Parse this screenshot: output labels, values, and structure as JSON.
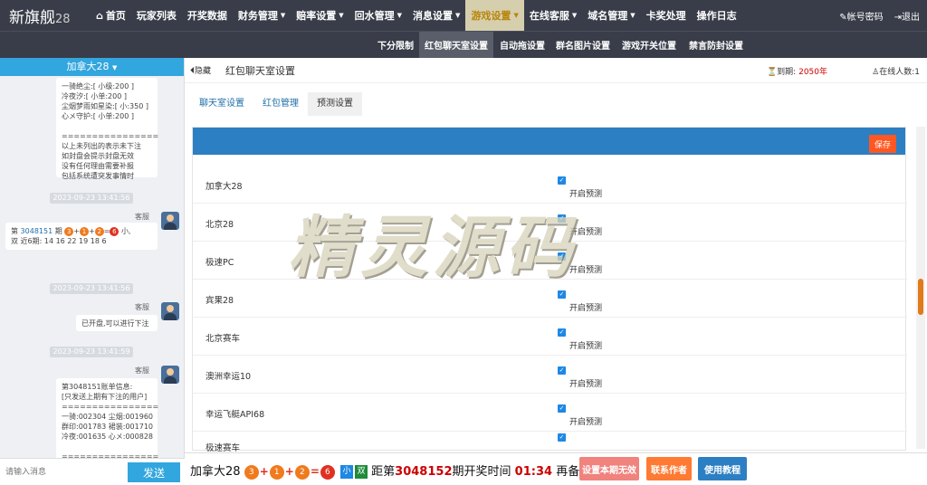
{
  "brand": {
    "name": "新旗舰",
    "suffix": "28"
  },
  "nav": [
    {
      "label": "首页",
      "icon": "home-icon"
    },
    {
      "label": "玩家列表"
    },
    {
      "label": "开奖数据"
    },
    {
      "label": "财务管理",
      "dropdown": true
    },
    {
      "label": "赔率设置",
      "dropdown": true
    },
    {
      "label": "回水管理",
      "dropdown": true
    },
    {
      "label": "消息设置",
      "dropdown": true
    },
    {
      "label": "游戏设置",
      "dropdown": true,
      "active": true
    },
    {
      "label": "在线客服",
      "dropdown": true
    },
    {
      "label": "域名管理",
      "dropdown": true
    },
    {
      "label": "卡奖处理"
    },
    {
      "label": "操作日志"
    }
  ],
  "top_right": {
    "account": "帐号密码",
    "logout": "退出"
  },
  "subnav": [
    "下分限制",
    "红包聊天室设置",
    "自动拖设置",
    "群名图片设置",
    "游戏开关位置",
    "禁言防封设置"
  ],
  "chat": {
    "room": "加拿大28",
    "msg1": "一骑绝尘:[ 小级:200 ]\n冷夜汐:[ 小单:200 ]\n尘烟梦雨如星染:[ 小:350 ]\n心メ守护:[ 小单:200 ]\n\n================\n以上未列出的表示未下注\n如封盘会提示封盘无效\n没有任何理由需要补报\n包括系统遭突发事情时",
    "ts1": "2023-09-23 13:41:56",
    "sender": "客服",
    "msg2": {
      "prefix": "第",
      "period": "3048151",
      "mid": "期",
      "balls": [
        "3",
        "1",
        "2"
      ],
      "sum": "6",
      "result": "小,",
      "line2": "双 近6期: 14 16 22 19 18 6"
    },
    "ts2": "2023-09-23 13:41:56",
    "msg3": "已开盘,可以进行下注",
    "ts3": "2023-09-23 13:41:59",
    "msg4": "第3048151账单信息:\n[只发送上期有下注的用户]\n================\n一骑:002304 尘烟:001960\n群印:001783 裙装:001710\n冷夜:001635 心メ:000828\n\n================",
    "input_placeholder": "请输入消息",
    "send": "发送"
  },
  "content": {
    "hide": "隐藏",
    "title": "红包聊天室设置",
    "expire_label": "到期:",
    "expire_year": "2050年",
    "online_label": "在线人数:",
    "online_count": "1",
    "tabs": [
      "聊天室设置",
      "红包管理",
      "预测设置"
    ],
    "active_tab": 2,
    "save": "保存",
    "check_label": "开启预测",
    "rows": [
      "加拿大28",
      "北京28",
      "极速PC",
      "宾果28",
      "北京赛车",
      "澳洲幸运10",
      "幸运飞艇API68",
      "极速赛车"
    ]
  },
  "watermark": "精灵源码",
  "bottom": {
    "lottery": "加拿大28",
    "balls": [
      "3",
      "1",
      "2"
    ],
    "sum": "6",
    "tag1": "小",
    "tag2": "双",
    "pre": "距第",
    "period": "3048152",
    "post": "期开奖时间",
    "countdown": "01:34",
    "remain": "再备",
    "btn1": "设置本期无效",
    "btn2": "联系作者",
    "btn3": "使用教程"
  },
  "colors": {
    "topbar": "#393d49",
    "chat_head": "#32a6de",
    "panel_head": "#2d7fc3",
    "save": "#ff5722",
    "btn1": "#f0837e",
    "btn2": "#ff7a33",
    "btn3": "#2d7fc3"
  }
}
